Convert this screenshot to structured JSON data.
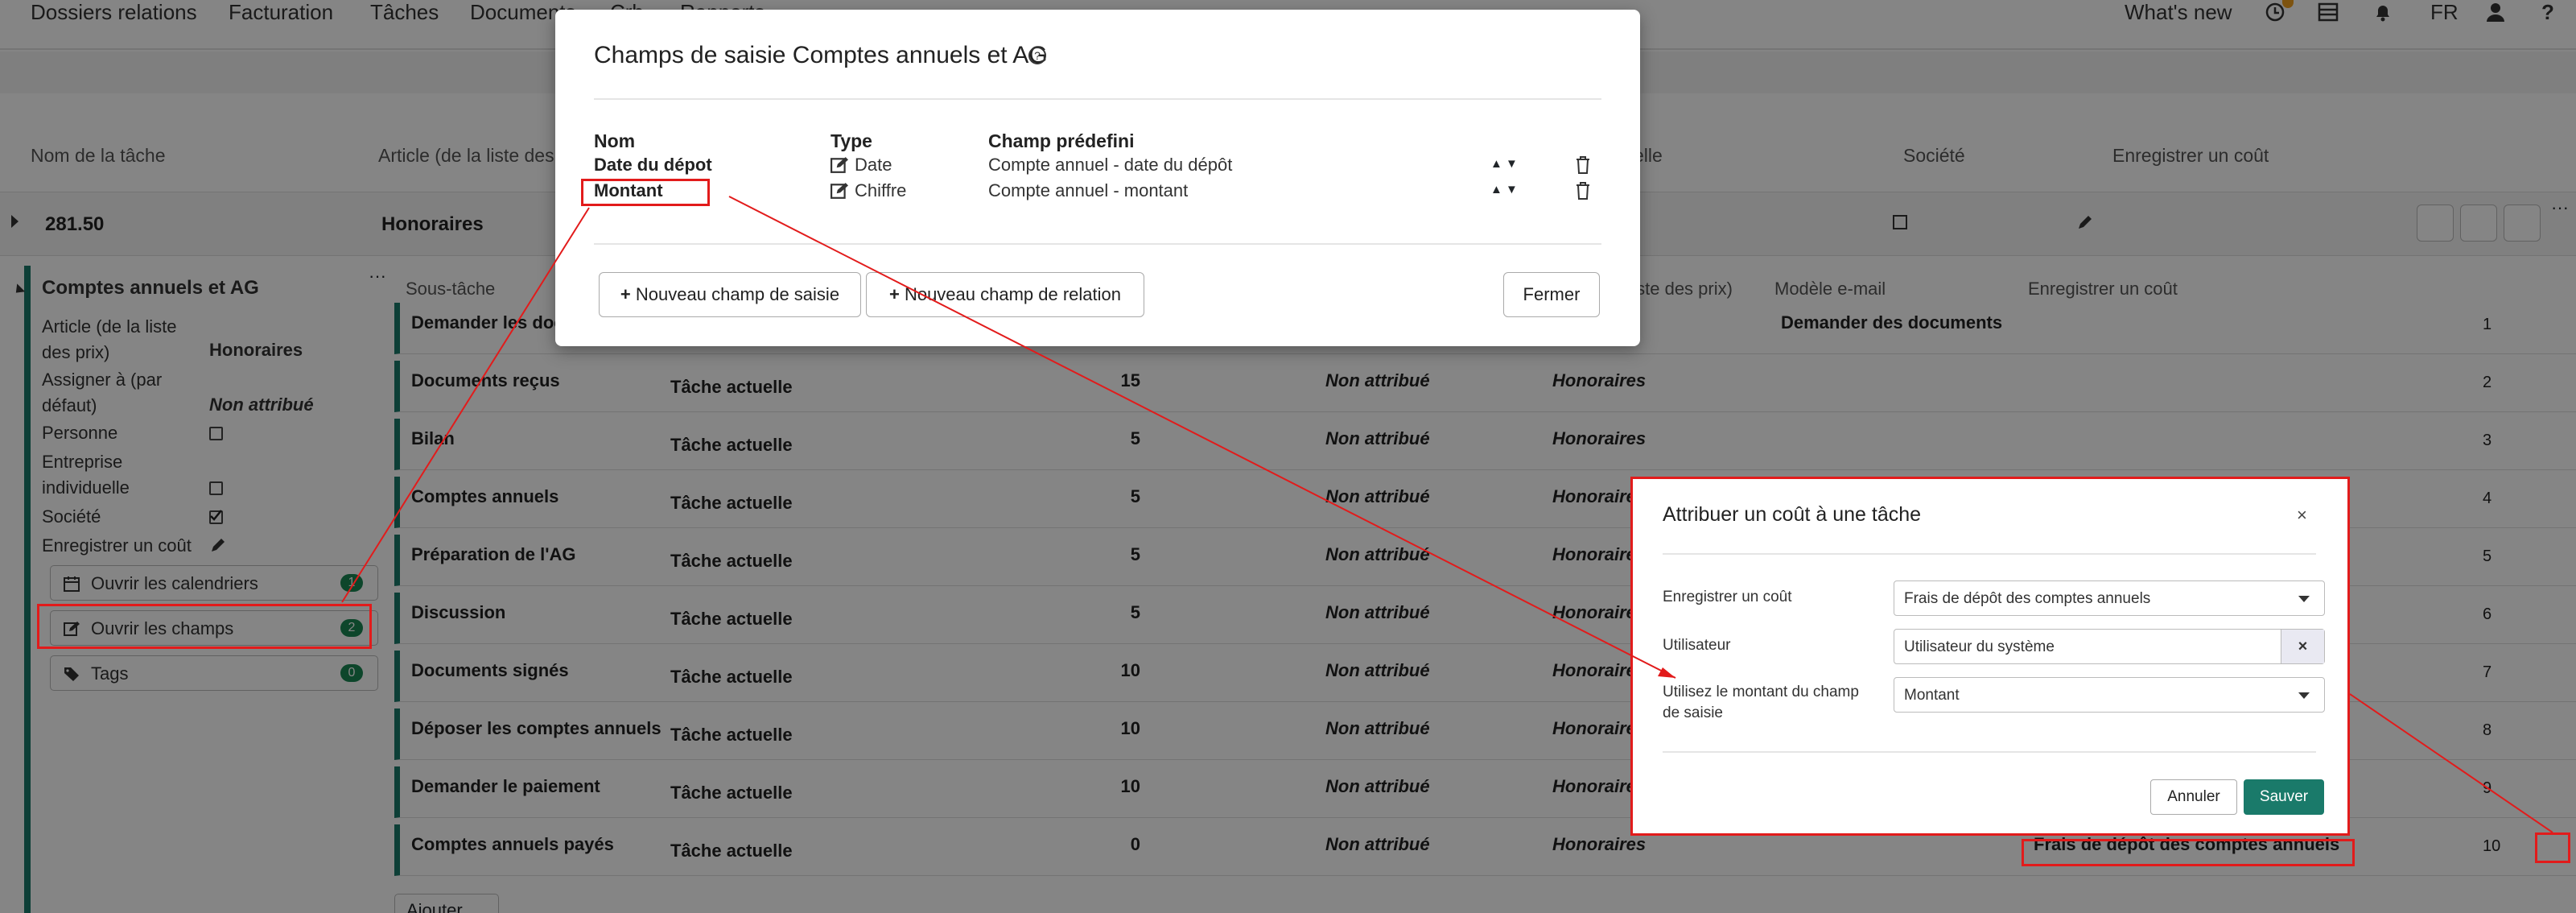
{
  "navbar": {
    "items": [
      "Dossiers relations",
      "Facturation",
      "Tâches",
      "Documents",
      "Crh",
      "Rapports"
    ],
    "whats_new": "What's new",
    "lang": "FR",
    "icons": [
      "clock-icon",
      "list-icon",
      "bell-icon",
      "user-icon",
      "help-icon"
    ],
    "help": "?"
  },
  "task_header": {
    "col_name": "Nom de la tâche",
    "col_article": "Article (de la liste des",
    "col_manuelle": "elle",
    "col_societe": "Société",
    "col_cost": "Enregistrer un coût"
  },
  "task_row": {
    "code": "281.50",
    "article": "Honoraires"
  },
  "sidebar": {
    "title": "Comptes annuels et AG",
    "article_label": "Article (de la liste des prix)",
    "article_value": "Honoraires",
    "assign_label": "Assigner à (par défaut)",
    "assign_value": "Non attribué",
    "personne_label": "Personne",
    "entreprise_label": "Entreprise individuelle",
    "societe_label": "Société",
    "cost_label": "Enregistrer un coût",
    "btn_calendars": "Ouvrir les calendriers",
    "btn_calendars_count": "1",
    "btn_fields": "Ouvrir les champs",
    "btn_fields_count": "2",
    "btn_tags": "Tags",
    "btn_tags_count": "0"
  },
  "subtasks": {
    "headers": {
      "subtask": "Sous-tâche",
      "article_list": "a liste des prix)",
      "email_model": "Modèle e-mail",
      "cost": "Enregistrer un coût"
    },
    "rows": [
      {
        "name": "Demander les doc",
        "relation": "",
        "days": "",
        "assign": "",
        "article": "",
        "cost": "Demander des documents",
        "order": "1"
      },
      {
        "name": "Documents reçus",
        "relation": "Tâche actuelle",
        "days": "15",
        "assign": "Non attribué",
        "article": "Honoraires",
        "cost": "",
        "order": "2"
      },
      {
        "name": "Bilan",
        "relation": "Tâche actuelle",
        "days": "5",
        "assign": "Non attribué",
        "article": "Honoraires",
        "cost": "",
        "order": "3"
      },
      {
        "name": "Comptes annuels",
        "relation": "Tâche actuelle",
        "days": "5",
        "assign": "Non attribué",
        "article": "Honoraires",
        "cost": "",
        "order": "4"
      },
      {
        "name": "Préparation de l'AG",
        "relation": "Tâche actuelle",
        "days": "5",
        "assign": "Non attribué",
        "article": "Honoraires",
        "cost": "",
        "order": "5"
      },
      {
        "name": "Discussion",
        "relation": "Tâche actuelle",
        "days": "5",
        "assign": "Non attribué",
        "article": "Honoraires",
        "cost": "",
        "order": "6"
      },
      {
        "name": "Documents signés",
        "relation": "Tâche actuelle",
        "days": "10",
        "assign": "Non attribué",
        "article": "Honoraires",
        "cost": "",
        "order": "7"
      },
      {
        "name": "Déposer les comptes annuels",
        "relation": "Tâche actuelle",
        "days": "10",
        "assign": "Non attribué",
        "article": "Honoraires",
        "cost": "",
        "order": "8"
      },
      {
        "name": "Demander le paiement",
        "relation": "Tâche actuelle",
        "days": "10",
        "assign": "Non attribué",
        "article": "Honoraires",
        "cost": "",
        "order": "9"
      },
      {
        "name": "Comptes annuels payés",
        "relation": "Tâche actuelle",
        "days": "0",
        "assign": "Non attribué",
        "article": "Honoraires",
        "cost": "Frais de dépôt des comptes annuels",
        "order": "10"
      }
    ],
    "add_label": "Ajouter"
  },
  "modal_fields": {
    "title": "Champs de saisie Comptes annuels et AG",
    "col_name": "Nom",
    "col_type": "Type",
    "col_predef": "Champ prédefini",
    "rows": [
      {
        "name": "Date du dépot",
        "type": "Date",
        "predef": "Compte annuel - date du dépôt"
      },
      {
        "name": "Montant",
        "type": "Chiffre",
        "predef": "Compte annuel - montant"
      }
    ],
    "btn_new_field": "Nouveau champ de saisie",
    "btn_new_relation": "Nouveau champ de relation",
    "btn_close": "Fermer"
  },
  "modal_cost": {
    "title": "Attribuer un coût à une tâche",
    "close": "×",
    "label_cost": "Enregistrer un coût",
    "value_cost": "Frais de dépôt des comptes annuels",
    "label_user": "Utilisateur",
    "value_user": "Utilisateur du système",
    "label_amount": "Utilisez le montant du champ de saisie",
    "value_amount": "Montant",
    "btn_cancel": "Annuler",
    "btn_save": "Sauver",
    "save_color": "#1a7a6a"
  },
  "annotation_color": "#e21b1b"
}
